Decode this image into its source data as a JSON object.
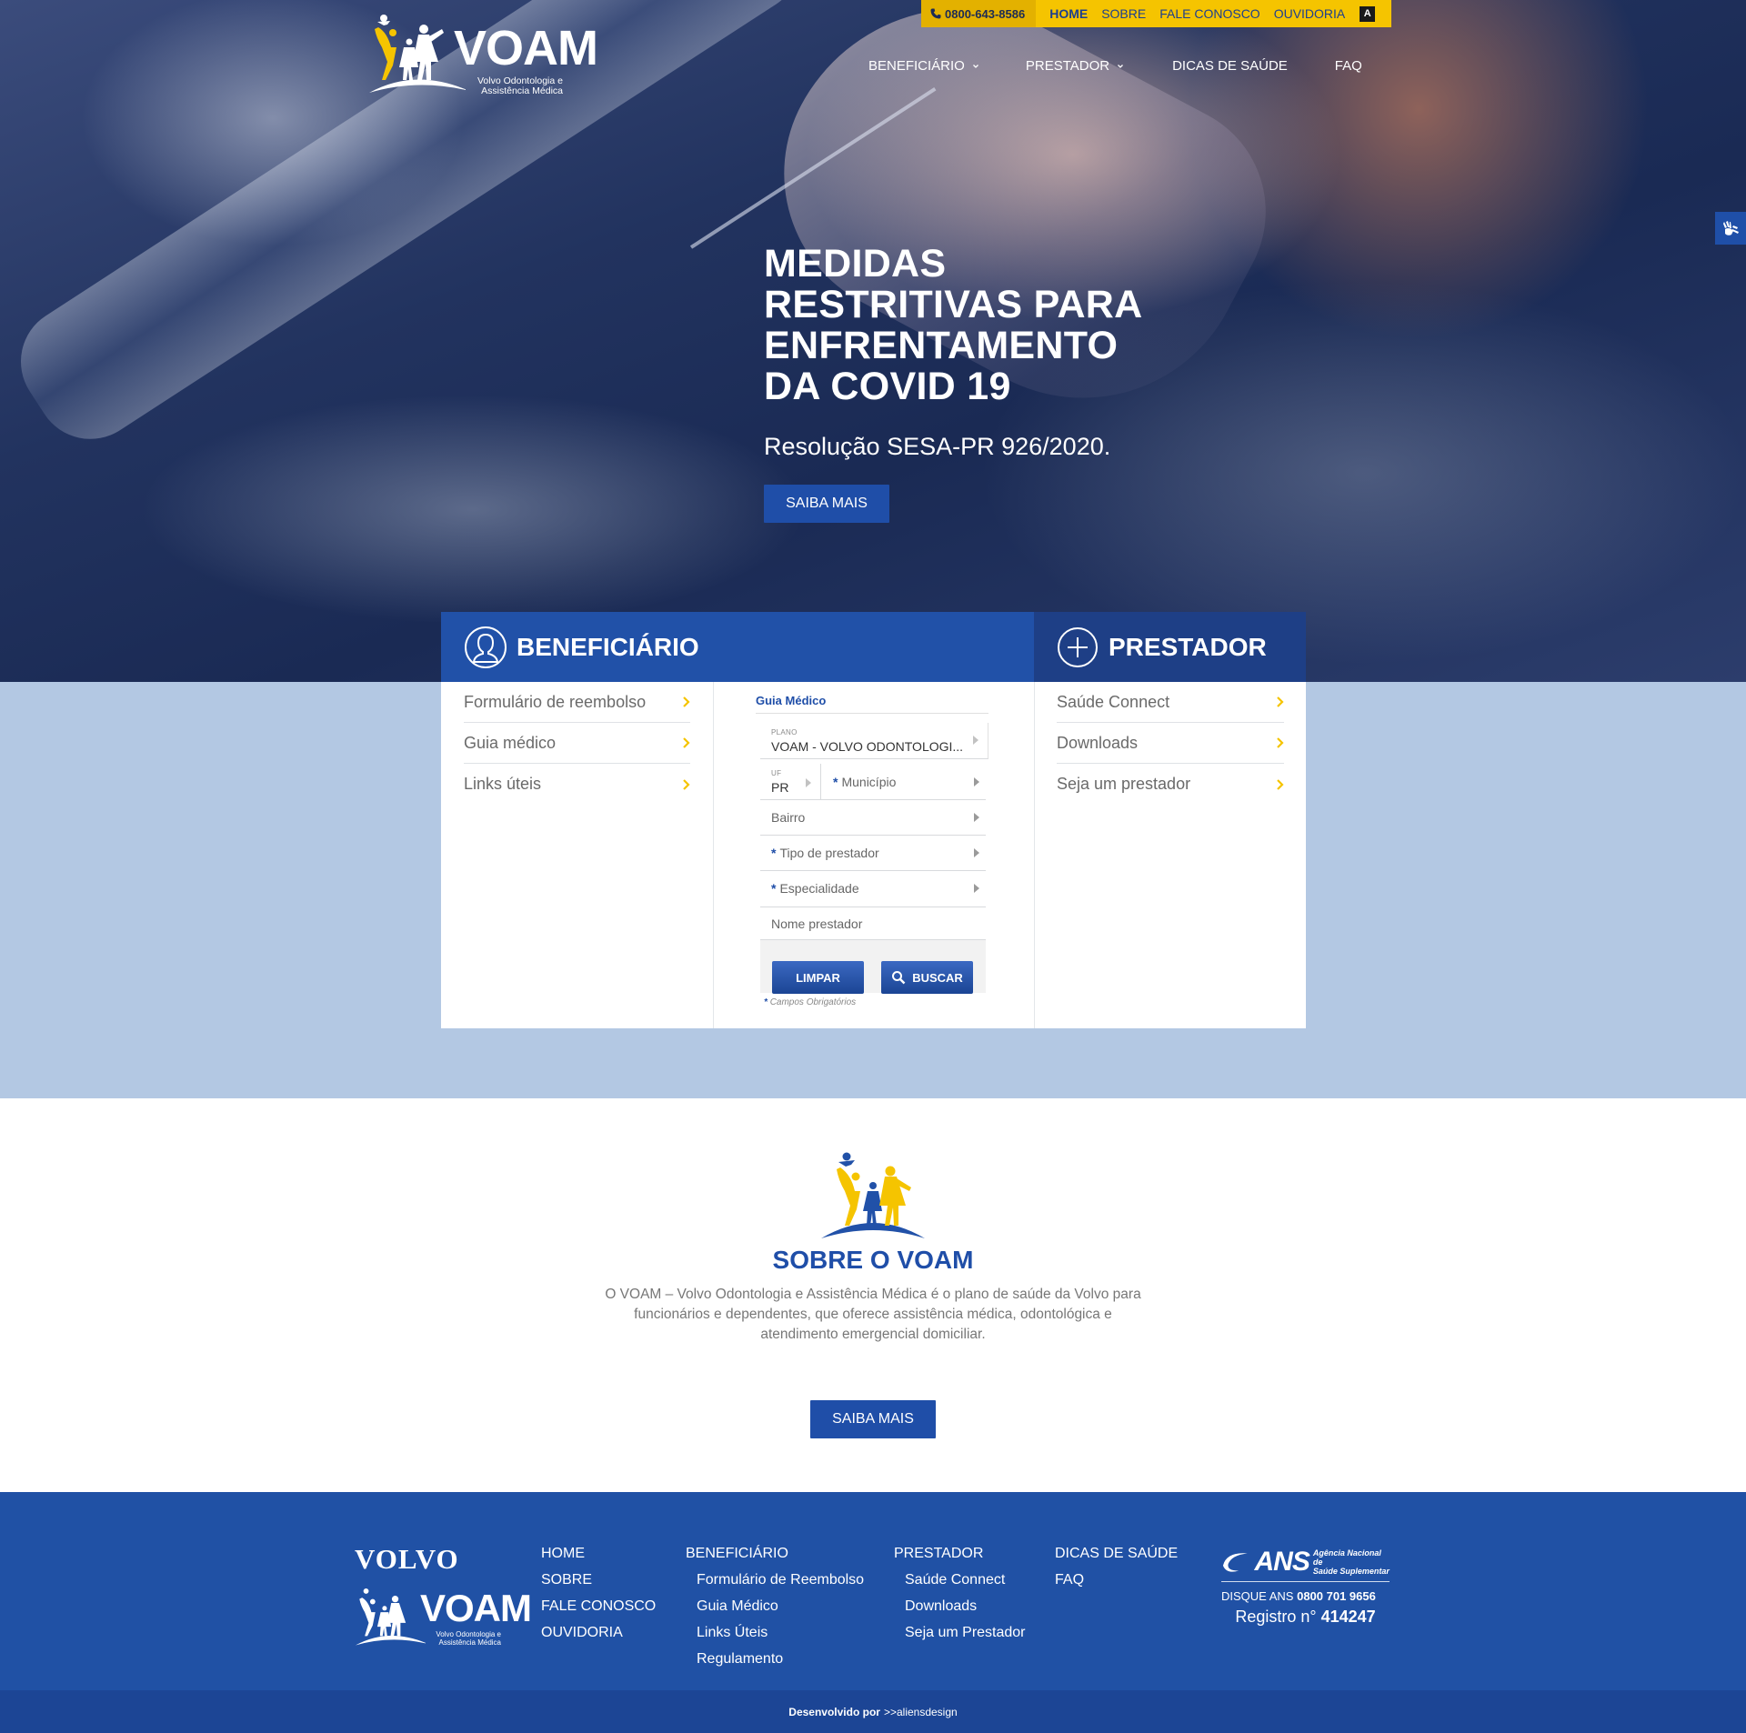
{
  "colors": {
    "brand_blue": "#2151a8",
    "dark_blue": "#1e3f86",
    "yellow": "#f5c400",
    "band": "#b3c8e3"
  },
  "topbar": {
    "phone": "0800-643-8586",
    "links": [
      "HOME",
      "SOBRE",
      "FALE CONOSCO",
      "OUVIDORIA"
    ],
    "font_toggle": "A"
  },
  "logo": {
    "name": "VOAM",
    "subtitle_line1": "Volvo Odontologia e",
    "subtitle_line2": "Assistência Médica"
  },
  "nav": {
    "items": [
      "BENEFICIÁRIO",
      "PRESTADOR",
      "DICAS DE SAÚDE",
      "FAQ"
    ]
  },
  "hero": {
    "title": "MEDIDAS RESTRITIVAS PARA ENFRENTAMENTO DA COVID 19",
    "subtitle": "Resolução SESA-PR 926/2020.",
    "cta": "SAIBA MAIS"
  },
  "beneficiario": {
    "title": "BENEFICIÁRIO",
    "links": [
      "Formulário de reembolso",
      "Guia médico",
      "Links úteis"
    ]
  },
  "prestador": {
    "title": "PRESTADOR",
    "links": [
      "Saúde Connect",
      "Downloads",
      "Seja um prestador"
    ]
  },
  "guia": {
    "title": "Guia Médico",
    "plano_label": "PLANO",
    "plano_value": "VOAM - VOLVO ODONTOLOGI...",
    "uf_label": "UF",
    "uf_value": "PR",
    "municipio": "Município",
    "bairro": "Bairro",
    "tipo": "Tipo de prestador",
    "especialidade": "Especialidade",
    "nome": "Nome prestador",
    "required_mark": "*",
    "btn_limpar": "LIMPAR",
    "btn_buscar": "BUSCAR",
    "required_note": "Campos Obrigatórios"
  },
  "about": {
    "title": "SOBRE O VOAM",
    "text": "O VOAM – Volvo Odontologia e Assistência Médica é o plano de saúde da Volvo para funcionários e dependentes, que oferece assistência médica, odontológica e atendimento emergencial domiciliar.",
    "cta": "SAIBA MAIS"
  },
  "footer": {
    "volvo": "VOLVO",
    "col1": [
      "HOME",
      "SOBRE",
      "FALE CONOSCO",
      "OUVIDORIA"
    ],
    "col2_head": "BENEFICIÁRIO",
    "col2": [
      "Formulário de Reembolso",
      "Guia Médico",
      "Links Úteis",
      "Regulamento"
    ],
    "col3_head": "PRESTADOR",
    "col3": [
      "Saúde Connect",
      "Downloads",
      "Seja um Prestador"
    ],
    "col4": [
      "DICAS DE SAÚDE",
      "FAQ"
    ],
    "ans": {
      "word": "ANS",
      "agency_line1": "Agência Nacional de",
      "agency_line2": "Saúde Suplementar",
      "disque_label": "DISQUE ANS",
      "disque_number": "0800 701 9656",
      "registro_label": "Registro n°",
      "registro_number": "414247"
    }
  },
  "credit": {
    "label": "Desenvolvido por",
    "author": ">>aliensdesign"
  }
}
